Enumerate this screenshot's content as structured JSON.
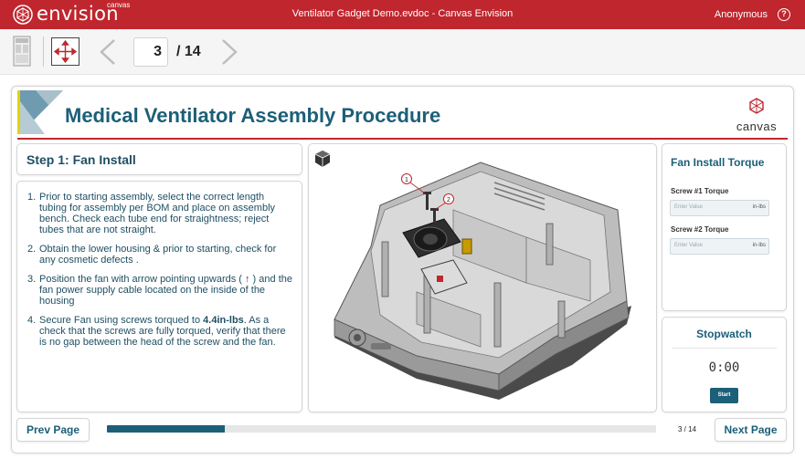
{
  "titlebar": {
    "brand": "envision",
    "brand_sup": "canvas",
    "window_title": "Ventilator Gadget Demo.evdoc - Canvas Envision",
    "user": "Anonymous",
    "help": "?"
  },
  "toolbar": {
    "current_page": "3",
    "total_pages": "/ 14",
    "icons": [
      "document-thumbnail-icon",
      "fit-expand-icon",
      "chevron-left-icon",
      "chevron-right-icon"
    ]
  },
  "document": {
    "title": "Medical Ventilator Assembly Procedure",
    "brand": "canvas"
  },
  "step": {
    "title": "Step 1: Fan Install",
    "items": [
      {
        "num": "1.",
        "text": "Prior to starting assembly, select the correct length tubing for assembly per BOM and place on assembly bench. Check each tube end for straightness; reject tubes that are not straight."
      },
      {
        "num": "2.",
        "text": "Obtain the lower housing & prior to starting, check for any cosmetic defects ."
      },
      {
        "num": "3.",
        "text": "Position the fan with arrow pointing upwards ( ↑ ) and the fan power supply cable located on the inside of the housing"
      },
      {
        "num": "4.",
        "pre": "Secure Fan using screws torqued to ",
        "bold": "4.4in-lbs",
        "post": ". As a check that the screws are fully torqued, verify that there is no gap between the head of the screw and the fan."
      }
    ]
  },
  "viewer": {
    "callouts": [
      "1",
      "2"
    ],
    "icons": [
      "3d-cube-icon"
    ]
  },
  "torque": {
    "title": "Fan Install Torque",
    "screw1_label": "Screw #1 Torque",
    "screw2_label": "Screw #2 Torque",
    "placeholder": "Enter Value",
    "unit": "in-lbs"
  },
  "stopwatch": {
    "title": "Stopwatch",
    "time": "0:00",
    "start": "Start"
  },
  "footer": {
    "prev": "Prev Page",
    "next": "Next Page",
    "progress_text": "3 / 14",
    "progress_fraction": 0.214
  },
  "colors": {
    "brand_red": "#c0262d",
    "accent_blue": "#1c5f78"
  }
}
